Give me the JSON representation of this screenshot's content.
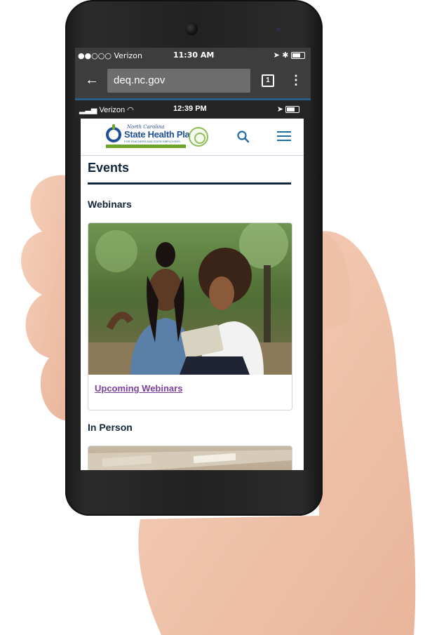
{
  "outer_status": {
    "carrier": "●●○○○ Verizon",
    "time": "11:30 AM"
  },
  "browser": {
    "url": "deq.nc.gov",
    "tab_count": "1"
  },
  "inner_status": {
    "carrier": "Verizon",
    "time": "12:39 PM"
  },
  "site": {
    "logo": {
      "script": "North Carolina",
      "title": "State Health Plan",
      "subtitle": "FOR TEACHERS AND STATE EMPLOYEES"
    },
    "page_title": "Events",
    "sections": [
      {
        "heading": "Webinars",
        "card_link": "Upcoming Webinars"
      },
      {
        "heading": "In Person"
      }
    ]
  },
  "colors": {
    "heading": "#12263a",
    "link": "#7b3f9e",
    "accent": "#1e6ea6",
    "logo_green": "#6ea42a"
  }
}
